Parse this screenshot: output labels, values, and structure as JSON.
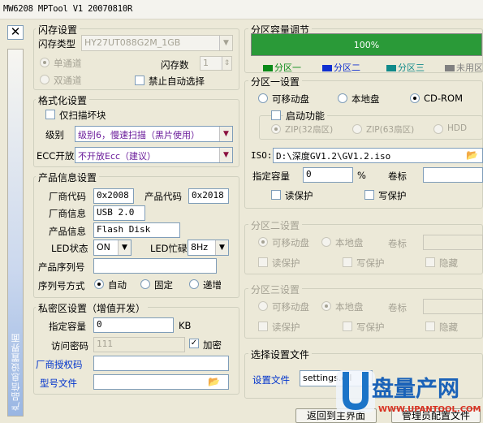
{
  "app": {
    "title": "MW6208 MPTool V1 20070810R",
    "side_tab": "产品信息设置界面"
  },
  "colors": {
    "progress": "#2a9a38",
    "part1": "#0a8a18",
    "part2": "#1030d0",
    "part3": "#108a8a",
    "unused": "#808080",
    "link": "#0033cc"
  },
  "flash": {
    "group": "闪存设置",
    "type_label": "闪存类型",
    "type_value": "HY27UT088G2M_1GB",
    "count_label": "闪存数",
    "count_value": "1",
    "single": "单通道",
    "dual": "双通道",
    "disable_auto": "禁止自动选择"
  },
  "format": {
    "group": "格式化设置",
    "scan_bad": "仅扫描坏块",
    "level_label": "级别",
    "level_value": "级别6，慢速扫描（黑片使用）",
    "ecc_label": "ECC开放",
    "ecc_value": "不开放Ecc（建议）"
  },
  "product": {
    "group": "产品信息设置",
    "vendor_code_label": "厂商代码",
    "vendor_code": "0x2008",
    "product_code_label": "产品代码",
    "product_code": "0x2018",
    "vendor_info_label": "厂商信息",
    "vendor_info": "USB 2.0",
    "product_info_label": "产品信息",
    "product_info": "Flash Disk",
    "led_state_label": "LED状态",
    "led_state": "ON",
    "led_busy_label": "LED忙碌",
    "led_busy": "8Hz",
    "serial_label": "产品序列号",
    "serial_value": "",
    "serial_mode_label": "序列号方式",
    "serial_auto": "自动",
    "serial_fixed": "固定",
    "serial_incr": "递增"
  },
  "secure": {
    "group": "私密区设置（增值开发）",
    "capacity_label": "指定容量",
    "capacity_value": "0",
    "unit": "KB",
    "password_label": "访问密码",
    "password_value": "111",
    "encrypt": "加密",
    "license_link": "厂商授权码",
    "license_value": "",
    "model_link": "型号文件",
    "model_value": ""
  },
  "capacity": {
    "group": "分区容量调节",
    "progress_value": 100,
    "progress_text": "100%",
    "legend": [
      "分区一",
      "分区二",
      "分区三",
      "未用区"
    ]
  },
  "part1": {
    "group": "分区一设置",
    "removable": "可移动盘",
    "local": "本地盘",
    "cdrom": "CD-ROM",
    "boot": "启动功能",
    "zip32": "ZIP(32扇区)",
    "zip63": "ZIP(63扇区)",
    "hdd": "HDD",
    "iso_label": "ISO:",
    "iso_value": "D:\\深度GV1.2\\GV1.2.iso",
    "capacity_label": "指定容量",
    "capacity_value": "0",
    "percent": "%",
    "label_label": "卷标",
    "label_value": "",
    "read_protect": "读保护",
    "write_protect": "写保护"
  },
  "part2": {
    "group": "分区二设置",
    "removable": "可移动盘",
    "local": "本地盘",
    "label_label": "卷标",
    "read_protect": "读保护",
    "write_protect": "写保护",
    "hidden": "隐藏"
  },
  "part3": {
    "group": "分区三设置",
    "removable": "可移动盘",
    "local": "本地盘",
    "label_label": "卷标",
    "read_protect": "读保护",
    "write_protect": "写保护",
    "hidden": "隐藏"
  },
  "select_file": {
    "group": "选择设置文件",
    "file_label": "设置文件",
    "file_value": "settings.dll"
  },
  "bottom": {
    "back_button": "返回到主界面",
    "save_button": "管理员配置文件"
  },
  "watermark": {
    "brand": "盘量产网",
    "url": "WWW.UPANTOOL.COM"
  }
}
